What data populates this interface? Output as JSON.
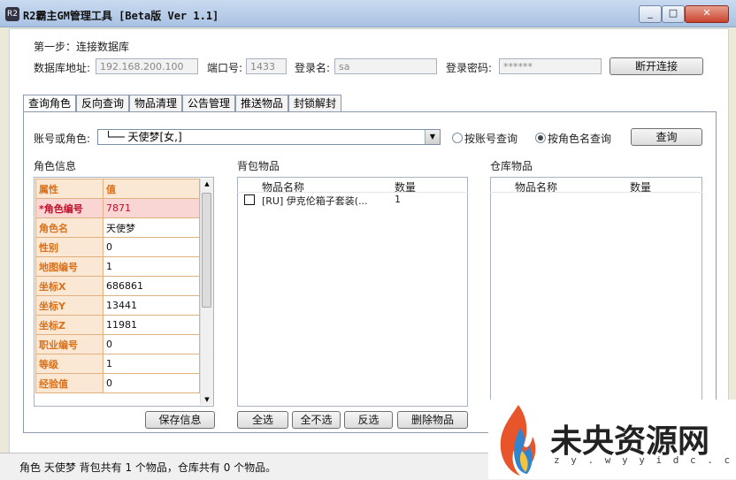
{
  "window": {
    "title": "R2霸主GM管理工具 [Beta版 Ver 1.1]",
    "app_icon_text": "R2",
    "min_icon": "minimize-icon",
    "max_icon": "maximize-icon",
    "close_icon": "close-icon"
  },
  "step1": {
    "heading": "第一步：连接数据库",
    "db_addr_label": "数据库地址:",
    "db_addr_value": "192.168.200.100",
    "port_label": "端口号:",
    "port_value": "1433",
    "login_label": "登录名:",
    "login_value": "sa",
    "password_label": "登录密码:",
    "password_value": "******",
    "disconnect_button": "断开连接"
  },
  "tabs": [
    "查询角色",
    "反向查询",
    "物品清理",
    "公告管理",
    "推送物品",
    "封锁解封"
  ],
  "query": {
    "account_label": "账号或角色:",
    "combo_value": "└── 天使梦[女,]",
    "radio_account": "按账号查询",
    "radio_role": "按角色名查询",
    "query_button": "查询"
  },
  "role_info": {
    "title": "角色信息",
    "header": [
      "属性",
      "值"
    ],
    "rows": [
      {
        "key": "*角色编号",
        "value": "7871"
      },
      {
        "key": "角色名",
        "value": "天使梦"
      },
      {
        "key": "性别",
        "value": "0"
      },
      {
        "key": "地图编号",
        "value": "1"
      },
      {
        "key": "坐标X",
        "value": "686861"
      },
      {
        "key": "坐标Y",
        "value": "13441"
      },
      {
        "key": "坐标Z",
        "value": "11981"
      },
      {
        "key": "职业编号",
        "value": "0"
      },
      {
        "key": "等级",
        "value": "1"
      },
      {
        "key": "经验值",
        "value": "0"
      }
    ],
    "save_button": "保存信息"
  },
  "backpack": {
    "title": "背包物品",
    "col_name": "物品名称",
    "col_qty": "数量",
    "items": [
      {
        "name": "[RU] 伊克伦箱子套装(...",
        "qty": "1"
      }
    ],
    "btn_select_all": "全选",
    "btn_select_none": "全不选",
    "btn_invert": "反选",
    "btn_delete": "删除物品"
  },
  "warehouse": {
    "title": "仓库物品",
    "col_name": "物品名称",
    "col_qty": "数量"
  },
  "status": {
    "text": "角色 天使梦 背包共有 1 个物品，仓库共有 0 个物品。"
  },
  "watermark": {
    "title": "未央资源网",
    "url": "z y . w y y i d c . c n"
  }
}
